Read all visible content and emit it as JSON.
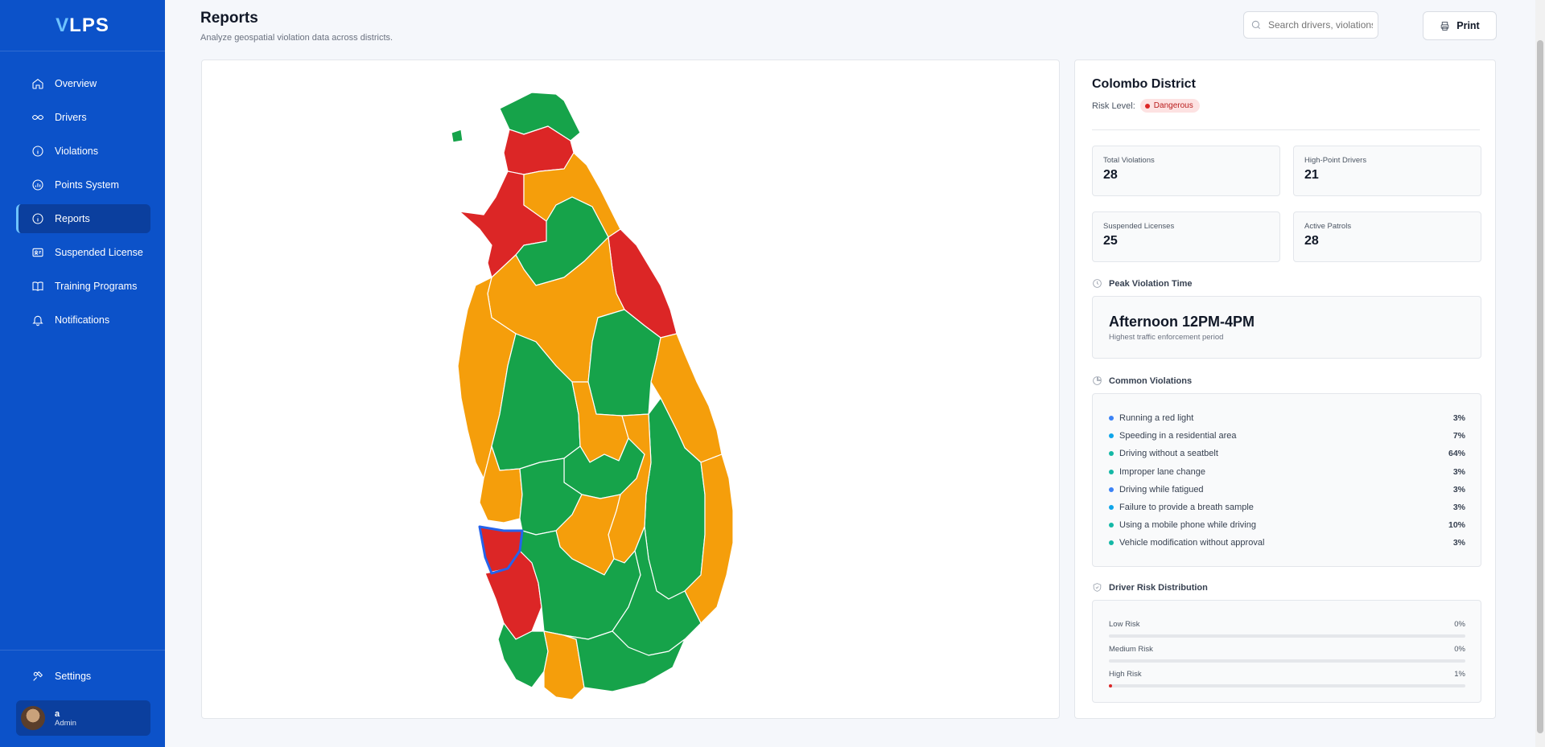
{
  "brand": {
    "v": "V",
    "rest": "LPS"
  },
  "nav": [
    {
      "label": "Overview",
      "icon": "home-icon"
    },
    {
      "label": "Drivers",
      "icon": "drivers-icon"
    },
    {
      "label": "Violations",
      "icon": "info-icon"
    },
    {
      "label": "Points System",
      "icon": "gauge-icon"
    },
    {
      "label": "Reports",
      "icon": "info-icon",
      "active": true
    },
    {
      "label": "Suspended License",
      "icon": "id-card-icon"
    },
    {
      "label": "Training Programs",
      "icon": "book-icon"
    },
    {
      "label": "Notifications",
      "icon": "bell-icon"
    }
  ],
  "settings": {
    "label": "Settings"
  },
  "user": {
    "name": "a",
    "role": "Admin"
  },
  "header": {
    "title": "Reports",
    "subtitle": "Analyze geospatial violation data across districts.",
    "search_placeholder": "Search drivers, violations...",
    "print_label": "Print"
  },
  "map": {
    "colors": {
      "safe": "#16a34a",
      "moderate": "#f59e0b",
      "dangerous": "#dc2626",
      "selected_outline": "#2563eb"
    }
  },
  "detail": {
    "district": "Colombo District",
    "risk_label": "Risk Level:",
    "risk_value": "Dangerous",
    "stats": [
      {
        "label": "Total Violations",
        "value": "28"
      },
      {
        "label": "High-Point Drivers",
        "value": "21"
      },
      {
        "label": "Suspended Licenses",
        "value": "25"
      },
      {
        "label": "Active Patrols",
        "value": "28"
      }
    ],
    "peak": {
      "title": "Peak Violation Time",
      "value": "Afternoon 12PM-4PM",
      "sub": "Highest traffic enforcement period"
    },
    "common": {
      "title": "Common Violations",
      "items": [
        {
          "label": "Running a red light",
          "pct": "3%",
          "color": "#3b82f6"
        },
        {
          "label": "Speeding in a residential area",
          "pct": "7%",
          "color": "#0ea5e9"
        },
        {
          "label": "Driving without a seatbelt",
          "pct": "64%",
          "color": "#14b8a6"
        },
        {
          "label": "Improper lane change",
          "pct": "3%",
          "color": "#14b8a6"
        },
        {
          "label": "Driving while fatigued",
          "pct": "3%",
          "color": "#3b82f6"
        },
        {
          "label": "Failure to provide a breath sample",
          "pct": "3%",
          "color": "#0ea5e9"
        },
        {
          "label": "Using a mobile phone while driving",
          "pct": "10%",
          "color": "#14b8a6"
        },
        {
          "label": "Vehicle modification without approval",
          "pct": "3%",
          "color": "#14b8a6"
        }
      ]
    },
    "risk_dist": {
      "title": "Driver Risk Distribution",
      "items": [
        {
          "label": "Low Risk",
          "pct": "0%",
          "fill": 0,
          "color": "#16a34a"
        },
        {
          "label": "Medium Risk",
          "pct": "0%",
          "fill": 0,
          "color": "#f59e0b"
        },
        {
          "label": "High Risk",
          "pct": "1%",
          "fill": 1,
          "color": "#dc2626"
        }
      ]
    }
  }
}
